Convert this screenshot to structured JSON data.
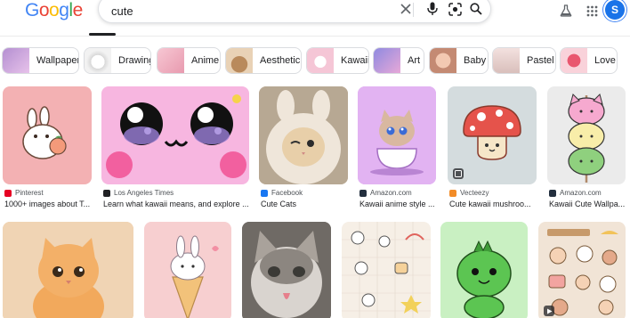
{
  "header": {
    "logo_letters": [
      "G",
      "o",
      "o",
      "g",
      "l",
      "e"
    ],
    "logo_colors": [
      "#4285f4",
      "#ea4335",
      "#fbbc05",
      "#4285f4",
      "#34a853",
      "#ea4335"
    ],
    "search_query": "cute",
    "icons": {
      "clear": "close-icon",
      "voice": "microphone-icon",
      "lens": "lens-icon",
      "search": "search-icon",
      "labs": "flask-icon",
      "apps": "apps-grid-icon"
    },
    "avatar_letter": "S"
  },
  "chips": [
    {
      "label": "Wallpaper",
      "color": "#c9a6d9"
    },
    {
      "label": "Drawing",
      "color": "#e8e8e8"
    },
    {
      "label": "Anime",
      "color": "#f2b7c7"
    },
    {
      "label": "Aesthetic",
      "color": "#d9b48f"
    },
    {
      "label": "Kawaii",
      "color": "#f5c6d6"
    },
    {
      "label": "Art",
      "color": "#9fa6e8"
    },
    {
      "label": "Baby",
      "color": "#e6b9a3"
    },
    {
      "label": "Pastel",
      "color": "#e8d0cf"
    },
    {
      "label": "Love",
      "color": "#f4a7b6"
    }
  ],
  "results_row1": [
    {
      "source": "Pinterest",
      "caption": "1000+ images about T...",
      "fav_color": "#e60023",
      "bg": "#f3b1b3"
    },
    {
      "source": "Los Angeles Times",
      "caption": "Learn what kawaii means, and explore ...",
      "fav_color": "#202124",
      "bg": "#f7b6e0"
    },
    {
      "source": "Facebook",
      "caption": "Cute Cats",
      "fav_color": "#1877f2",
      "bg": "#d8c4ab"
    },
    {
      "source": "Amazon.com",
      "caption": "Kawaii anime style ...",
      "fav_color": "#232f3e",
      "bg": "#d9a6f0"
    },
    {
      "source": "Vecteezy",
      "caption": "Cute kawaii mushroo...",
      "fav_color": "#f28c28",
      "bg": "#d4dcde"
    },
    {
      "source": "Amazon.com",
      "caption": "Kawaii Cute Wallpa...",
      "fav_color": "#232f3e",
      "bg": "#ebebeb"
    }
  ],
  "results_row2": [
    {
      "bg": "#f2cda5"
    },
    {
      "bg": "#f7cfd0"
    },
    {
      "bg": "#8f8a84"
    },
    {
      "bg": "#f6efe6"
    },
    {
      "bg": "#c9f0c2"
    },
    {
      "bg": "#f1e4d6"
    }
  ]
}
